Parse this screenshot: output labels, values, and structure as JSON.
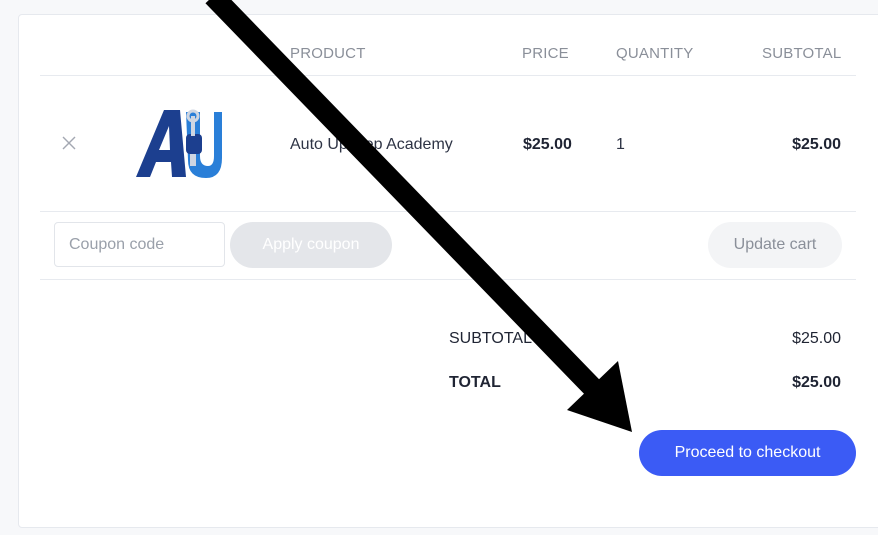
{
  "table": {
    "headers": {
      "product": "PRODUCT",
      "price": "PRICE",
      "quantity": "QUANTITY",
      "subtotal": "SUBTOTAL"
    },
    "rows": [
      {
        "remove_icon": "close-icon",
        "thumbnail_logo_text": "AU",
        "product": "Auto Upkeep Academy",
        "price": "$25.00",
        "quantity": "1",
        "subtotal": "$25.00"
      }
    ]
  },
  "actions": {
    "coupon_placeholder": "Coupon code",
    "apply_coupon_label": "Apply coupon",
    "update_cart_label": "Update cart"
  },
  "totals": {
    "subtotal_label": "SUBTOTAL",
    "subtotal_value": "$25.00",
    "total_label": "TOTAL",
    "total_value": "$25.00"
  },
  "checkout": {
    "label": "Proceed to checkout"
  },
  "colors": {
    "accent": "#3b5bf5",
    "logo_dark_blue": "#1c3f8f",
    "logo_light_blue": "#2a7fd8",
    "annotation_arrow": "#000000"
  },
  "annotation": {
    "icon": "arrow-pointer-icon"
  }
}
